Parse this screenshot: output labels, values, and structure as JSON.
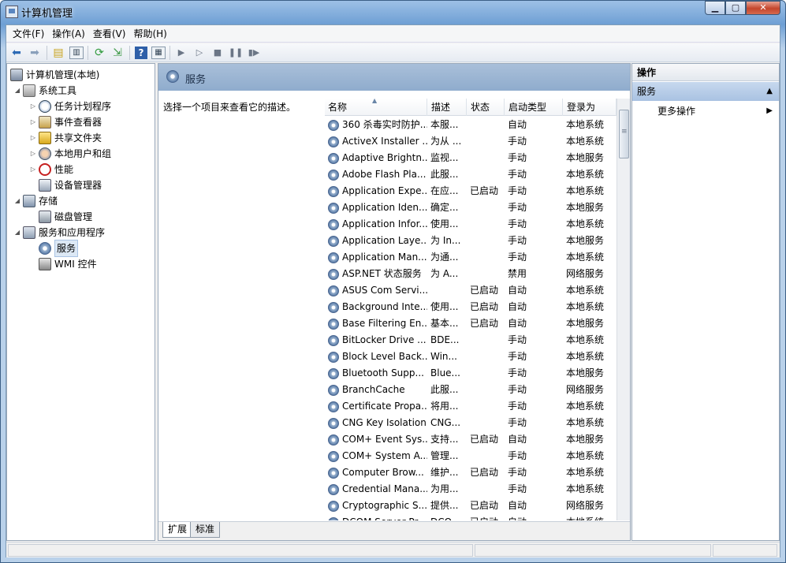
{
  "window": {
    "title": "计算机管理"
  },
  "menu": [
    "文件(F)",
    "操作(A)",
    "查看(V)",
    "帮助(H)"
  ],
  "tree": [
    {
      "label": "计算机管理(本地)",
      "icon": "computer",
      "level": 0,
      "toggle": ""
    },
    {
      "label": "系统工具",
      "icon": "tools",
      "level": 1,
      "toggle": "◢"
    },
    {
      "label": "任务计划程序",
      "icon": "clock",
      "level": 2,
      "toggle": "▷"
    },
    {
      "label": "事件查看器",
      "icon": "event",
      "level": 2,
      "toggle": "▷"
    },
    {
      "label": "共享文件夹",
      "icon": "share",
      "level": 2,
      "toggle": "▷"
    },
    {
      "label": "本地用户和组",
      "icon": "users",
      "level": 2,
      "toggle": "▷"
    },
    {
      "label": "性能",
      "icon": "perf",
      "level": 2,
      "toggle": "▷"
    },
    {
      "label": "设备管理器",
      "icon": "device",
      "level": 2,
      "toggle": ""
    },
    {
      "label": "存储",
      "icon": "storage",
      "level": 1,
      "toggle": "◢"
    },
    {
      "label": "磁盘管理",
      "icon": "disk",
      "level": 2,
      "toggle": ""
    },
    {
      "label": "服务和应用程序",
      "icon": "svcapp",
      "level": 1,
      "toggle": "◢"
    },
    {
      "label": "服务",
      "icon": "gear",
      "level": 2,
      "toggle": "",
      "selected": true
    },
    {
      "label": "WMI 控件",
      "icon": "wmi",
      "level": 2,
      "toggle": ""
    }
  ],
  "center": {
    "title": "服务",
    "description": "选择一个项目来查看它的描述。",
    "columns": [
      "名称",
      "描述",
      "状态",
      "启动类型",
      "登录为"
    ],
    "rows": [
      [
        "360 杀毒实时防护...",
        "本服...",
        "",
        "自动",
        "本地系统"
      ],
      [
        "ActiveX Installer ...",
        "为从 ...",
        "",
        "手动",
        "本地系统"
      ],
      [
        "Adaptive Brightn...",
        "监视...",
        "",
        "手动",
        "本地服务"
      ],
      [
        "Adobe Flash Pla...",
        "此服...",
        "",
        "手动",
        "本地系统"
      ],
      [
        "Application Expe...",
        "在应...",
        "已启动",
        "手动",
        "本地系统"
      ],
      [
        "Application Iden...",
        "确定...",
        "",
        "手动",
        "本地服务"
      ],
      [
        "Application Infor...",
        "使用...",
        "",
        "手动",
        "本地系统"
      ],
      [
        "Application Laye...",
        "为 In...",
        "",
        "手动",
        "本地服务"
      ],
      [
        "Application Man...",
        "为通...",
        "",
        "手动",
        "本地系统"
      ],
      [
        "ASP.NET 状态服务",
        "为 A...",
        "",
        "禁用",
        "网络服务"
      ],
      [
        "ASUS Com Servi...",
        "",
        "已启动",
        "自动",
        "本地系统"
      ],
      [
        "Background Inte...",
        "使用...",
        "已启动",
        "自动",
        "本地系统"
      ],
      [
        "Base Filtering En...",
        "基本...",
        "已启动",
        "自动",
        "本地服务"
      ],
      [
        "BitLocker Drive ...",
        "BDE...",
        "",
        "手动",
        "本地系统"
      ],
      [
        "Block Level Back...",
        "Win...",
        "",
        "手动",
        "本地系统"
      ],
      [
        "Bluetooth Supp...",
        "Blue...",
        "",
        "手动",
        "本地服务"
      ],
      [
        "BranchCache",
        "此服...",
        "",
        "手动",
        "网络服务"
      ],
      [
        "Certificate Propa...",
        "将用...",
        "",
        "手动",
        "本地系统"
      ],
      [
        "CNG Key Isolation",
        "CNG...",
        "",
        "手动",
        "本地系统"
      ],
      [
        "COM+ Event Sys...",
        "支持...",
        "已启动",
        "自动",
        "本地服务"
      ],
      [
        "COM+ System A...",
        "管理...",
        "",
        "手动",
        "本地系统"
      ],
      [
        "Computer Brow...",
        "维护...",
        "已启动",
        "手动",
        "本地系统"
      ],
      [
        "Credential Mana...",
        "为用...",
        "",
        "手动",
        "本地系统"
      ],
      [
        "Cryptographic S...",
        "提供...",
        "已启动",
        "自动",
        "网络服务"
      ],
      [
        "DCOM Server Pr...",
        "DCO...",
        "已启动",
        "自动",
        "本地系统"
      ]
    ],
    "tabs": [
      "扩展",
      "标准"
    ]
  },
  "actions": {
    "header": "操作",
    "section": "服务",
    "item": "更多操作"
  }
}
